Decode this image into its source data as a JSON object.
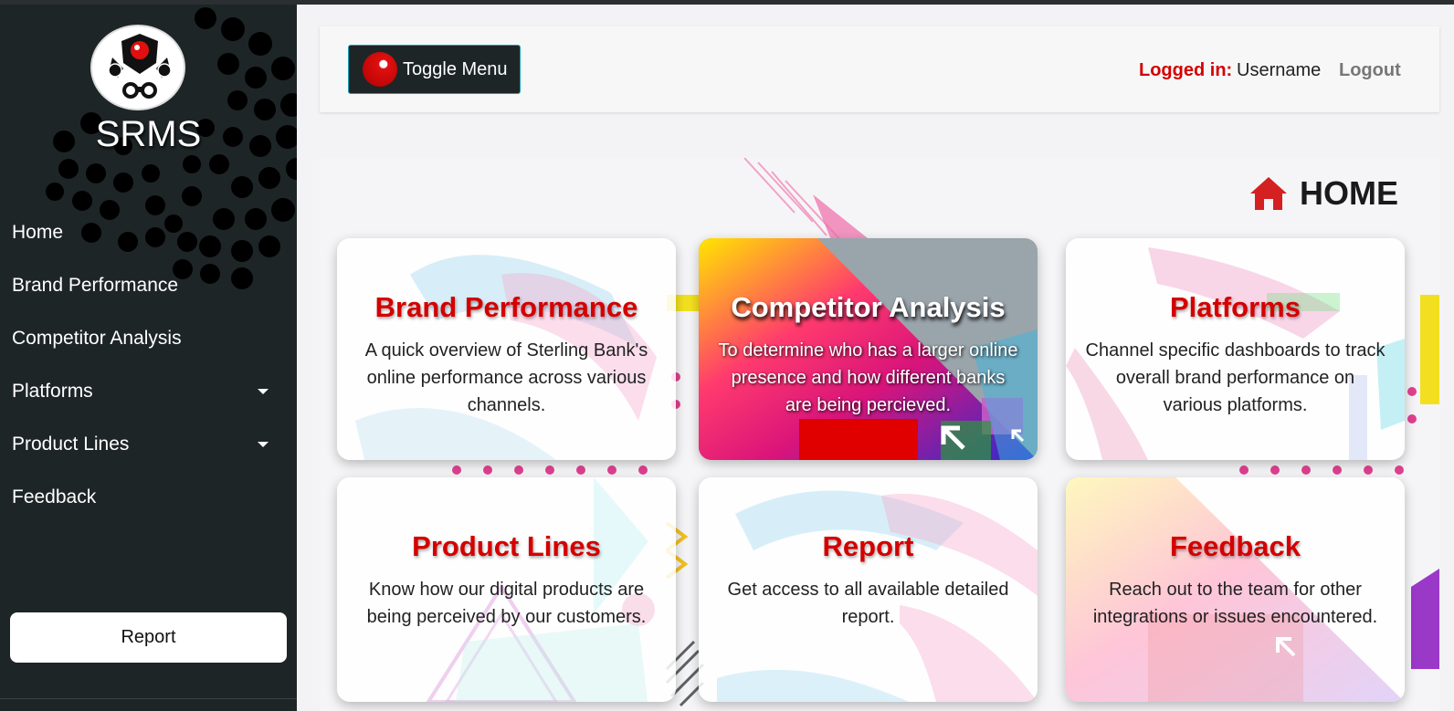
{
  "sidebar": {
    "brand": "SRMS",
    "items": [
      {
        "label": "Home"
      },
      {
        "label": "Brand Performance"
      },
      {
        "label": "Competitor Analysis"
      },
      {
        "label": "Platforms"
      },
      {
        "label": "Product Lines"
      },
      {
        "label": "Feedback"
      }
    ],
    "report_button": "Report"
  },
  "header": {
    "toggle_label": "Toggle Menu",
    "logged_in_label": "Logged in:",
    "username": "Username",
    "logout_label": "Logout"
  },
  "main": {
    "page_title": "HOME",
    "cards": [
      {
        "title": "Brand Performance",
        "description": "A quick overview of Sterling Bank's online performance across various channels."
      },
      {
        "title": "Competitor Analysis",
        "description": "To determine who has a larger online presence and how different banks are being percieved."
      },
      {
        "title": "Platforms",
        "description": "Channel specific dashboards to track overall brand performance on various platforms."
      },
      {
        "title": "Product Lines",
        "description": "Know how our digital products are being perceived by our customers."
      },
      {
        "title": "Report",
        "description": "Get access to all available detailed report."
      },
      {
        "title": "Feedback",
        "description": "Reach out to the team for other integrations or issues encountered."
      }
    ]
  },
  "colors": {
    "sidebar_bg": "#1e2527",
    "accent_red": "#d40000",
    "toggle_border": "#17a2b8"
  }
}
